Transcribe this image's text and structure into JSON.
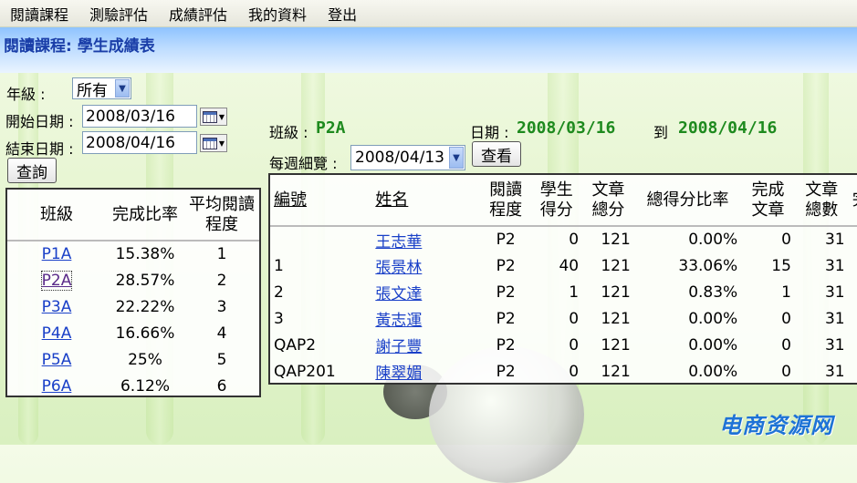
{
  "menu": [
    "閱讀課程",
    "測驗評估",
    "成績評估",
    "我的資料",
    "登出"
  ],
  "page_title": "閱讀課程: 學生成績表",
  "filters": {
    "grade_label": "年級 :",
    "grade_value": "所有",
    "start_label": "開始日期 :",
    "start_value": "2008/03/16",
    "end_label": "結束日期 :",
    "end_value": "2008/04/16",
    "query_button": "查詢"
  },
  "summary": {
    "headers": [
      "班級",
      "完成比率",
      "平均閱讀程度"
    ],
    "rows": [
      {
        "class": "P1A",
        "rate": "15.38%",
        "level": "1"
      },
      {
        "class": "P2A",
        "rate": "28.57%",
        "level": "2"
      },
      {
        "class": "P3A",
        "rate": "22.22%",
        "level": "3"
      },
      {
        "class": "P4A",
        "rate": "16.66%",
        "level": "4"
      },
      {
        "class": "P5A",
        "rate": "25%",
        "level": "5"
      },
      {
        "class": "P6A",
        "rate": "6.12%",
        "level": "6"
      }
    ]
  },
  "info": {
    "class_label": "班級 :",
    "class_value": "P2A",
    "date_label": "日期 :",
    "date_from": "2008/03/16",
    "to_label": "到",
    "date_to": "2008/04/16",
    "week_label": "每週細覽 :",
    "week_value": "2008/04/13",
    "view_button": "查看"
  },
  "students": {
    "headers": [
      "編號",
      "姓名",
      "閱讀程度",
      "學生得分",
      "文章總分",
      "總得分比率",
      "完成文章",
      "文章總數",
      "完"
    ],
    "rows": [
      {
        "id": "",
        "name": "王志華",
        "level": "P2",
        "score": "0",
        "total": "121",
        "ratio": "0.00%",
        "done": "0",
        "articles": "31"
      },
      {
        "id": "1",
        "name": "張景林",
        "level": "P2",
        "score": "40",
        "total": "121",
        "ratio": "33.06%",
        "done": "15",
        "articles": "31"
      },
      {
        "id": "2",
        "name": "張文達",
        "level": "P2",
        "score": "1",
        "total": "121",
        "ratio": "0.83%",
        "done": "1",
        "articles": "31"
      },
      {
        "id": "3",
        "name": "黃志運",
        "level": "P2",
        "score": "0",
        "total": "121",
        "ratio": "0.00%",
        "done": "0",
        "articles": "31"
      },
      {
        "id": "QAP2",
        "name": "謝子豐",
        "level": "P2",
        "score": "0",
        "total": "121",
        "ratio": "0.00%",
        "done": "0",
        "articles": "31"
      },
      {
        "id": "QAP201",
        "name": "陳翠媚",
        "level": "P2",
        "score": "0",
        "total": "121",
        "ratio": "0.00%",
        "done": "0",
        "articles": "31"
      }
    ]
  },
  "watermark": "电商资源网"
}
